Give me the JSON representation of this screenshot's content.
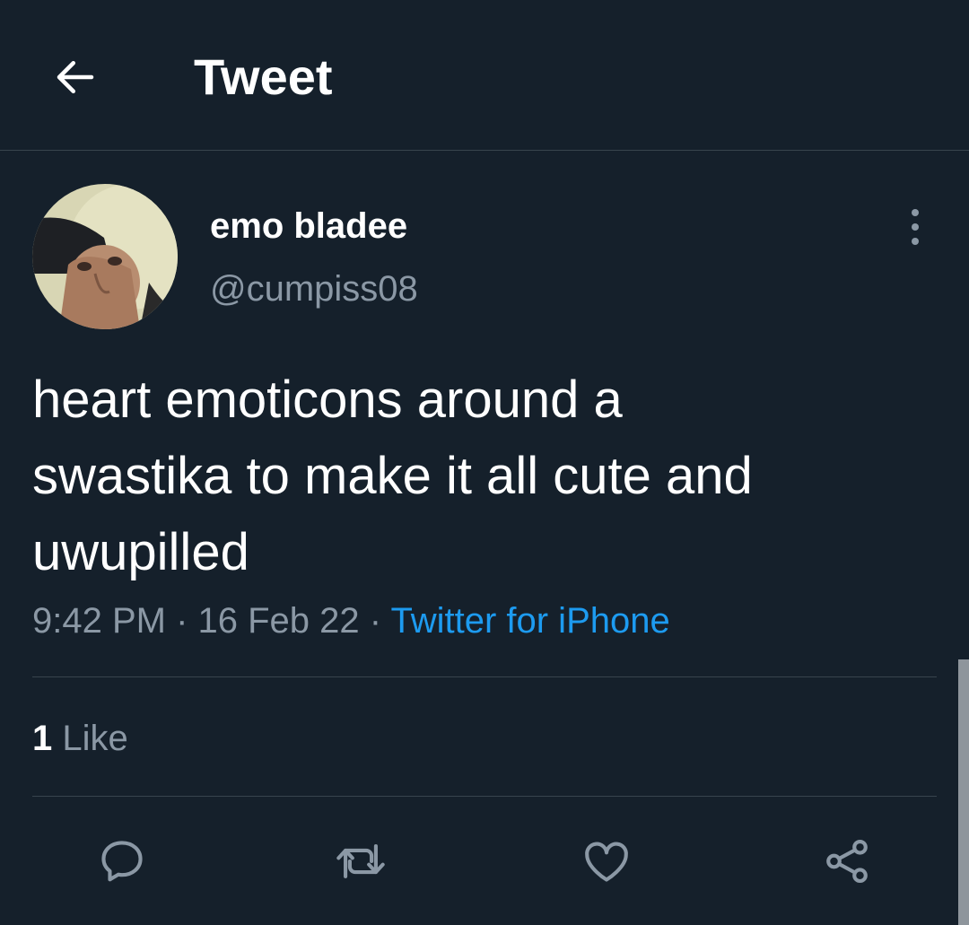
{
  "header": {
    "back_icon": "arrow-left-icon",
    "title": "Tweet"
  },
  "tweet": {
    "author": {
      "display_name": "emo bladee",
      "handle": "@cumpiss08"
    },
    "text": "heart emoticons around a\nswastika to make it all cute and\nuwupilled",
    "time": "9:42 PM",
    "separator": " · ",
    "date": "16 Feb 22",
    "source": "Twitter for iPhone",
    "likes": {
      "count": "1",
      "label": "Like"
    }
  },
  "actions": [
    {
      "icon": "reply-icon"
    },
    {
      "icon": "retweet-icon"
    },
    {
      "icon": "heart-icon"
    },
    {
      "icon": "share-icon"
    }
  ],
  "colors": {
    "background": "#15202b",
    "text": "#ffffff",
    "secondary_text": "#8b98a5",
    "link": "#1d9bf0",
    "divider": "#38444d"
  }
}
